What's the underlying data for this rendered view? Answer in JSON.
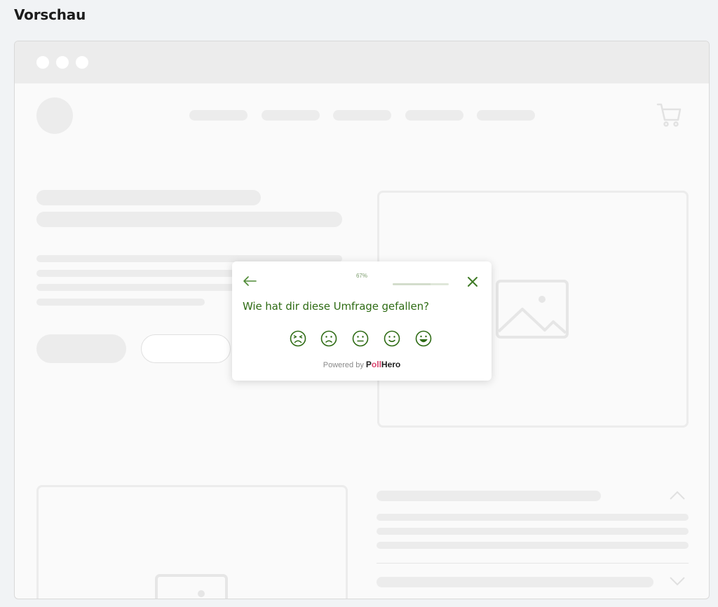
{
  "page": {
    "title": "Vorschau"
  },
  "survey": {
    "progress_label": "67%",
    "progress_value": 0.67,
    "question": "Wie hat dir diese Umfrage gefallen?",
    "rating_options": [
      "very-unhappy-face-icon",
      "unhappy-face-icon",
      "neutral-face-icon",
      "happy-face-icon",
      "very-happy-face-icon"
    ],
    "powered_by": "Powered by",
    "brand_prefix": "P",
    "brand_accent": "oll",
    "brand_suffix": "Hero"
  },
  "colors": {
    "accent_green": "#2e6b14",
    "brand_pink": "#d9466f",
    "placeholder_gray": "#ececec"
  }
}
